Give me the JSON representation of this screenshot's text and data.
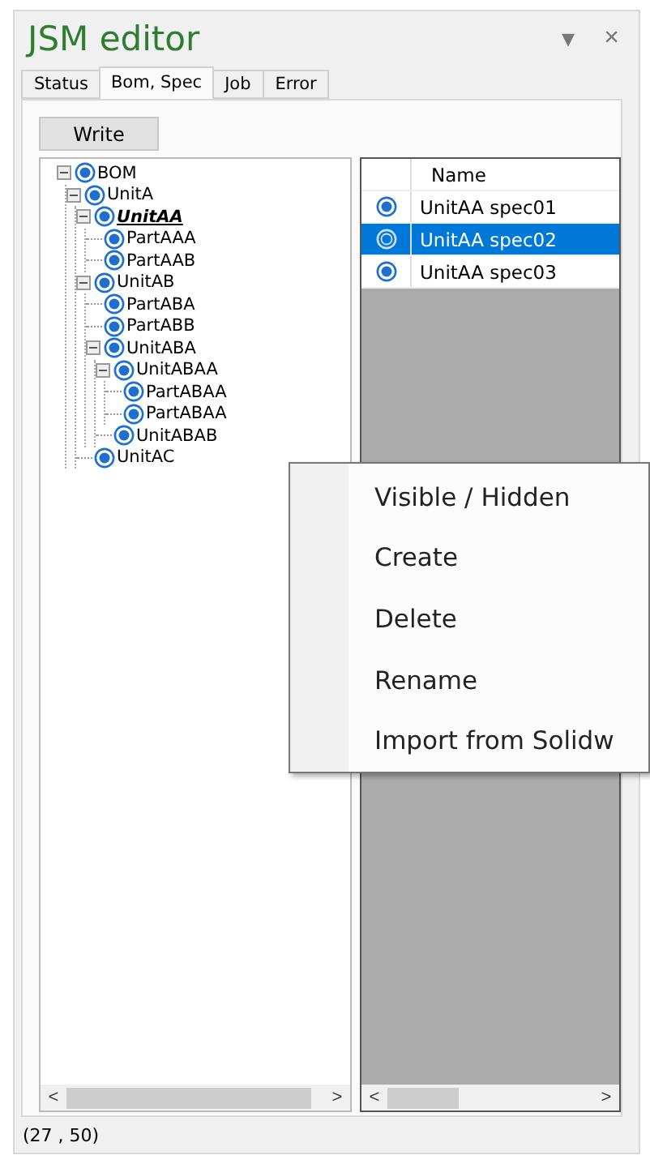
{
  "window": {
    "title": "JSM editor",
    "menu_glyph": "▾",
    "close_glyph": "×"
  },
  "tabs": [
    {
      "label": "Status",
      "selected": false
    },
    {
      "label": "Bom, Spec",
      "selected": true
    },
    {
      "label": "Job",
      "selected": false
    },
    {
      "label": "Error",
      "selected": false
    }
  ],
  "write_button": "Write",
  "tree": [
    {
      "label": "BOM",
      "expanded": true,
      "selected": false,
      "children": [
        {
          "label": "UnitA",
          "expanded": true,
          "selected": false,
          "children": [
            {
              "label": "UnitAA",
              "expanded": true,
              "selected": true,
              "children": [
                {
                  "label": "PartAAA",
                  "selected": false
                },
                {
                  "label": "PartAAB",
                  "selected": false
                }
              ]
            },
            {
              "label": "UnitAB",
              "expanded": true,
              "selected": false,
              "children": [
                {
                  "label": "PartABA",
                  "selected": false
                },
                {
                  "label": "PartABB",
                  "selected": false
                },
                {
                  "label": "UnitABA",
                  "expanded": true,
                  "selected": false,
                  "children": [
                    {
                      "label": "UnitABAA",
                      "expanded": true,
                      "selected": false,
                      "children": [
                        {
                          "label": "PartABAA",
                          "selected": false
                        },
                        {
                          "label": "PartABAA",
                          "selected": false
                        }
                      ]
                    },
                    {
                      "label": "UnitABAB",
                      "selected": false
                    }
                  ]
                }
              ]
            },
            {
              "label": "UnitAC",
              "selected": false
            }
          ]
        }
      ]
    }
  ],
  "tree_scroll": {
    "left": "<",
    "right": ">"
  },
  "grid": {
    "columns": [
      "Name"
    ],
    "rows": [
      {
        "name": "UnitAA spec01",
        "selected": false
      },
      {
        "name": "UnitAA spec02",
        "selected": true
      },
      {
        "name": "UnitAA spec03",
        "selected": false
      }
    ]
  },
  "grid_scroll": {
    "left": "<",
    "right": ">"
  },
  "context_menu": [
    "Visible / Hidden",
    "Create",
    "Delete",
    "Rename",
    "Import from Solidw"
  ],
  "status_bar": "(27 , 50)"
}
